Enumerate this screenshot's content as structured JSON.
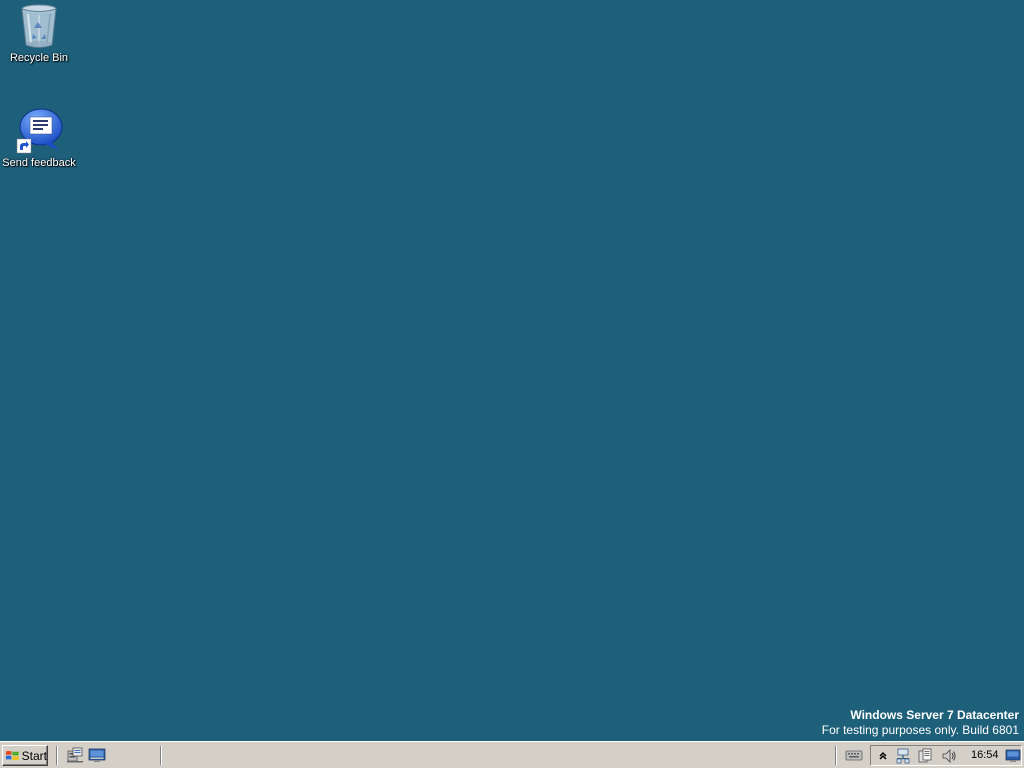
{
  "desktop": {
    "background_color": "#1e5f7a",
    "icons": [
      {
        "label": "Recycle Bin",
        "icon": "recycle-bin-icon"
      },
      {
        "label": "Send feedback",
        "icon": "send-feedback-icon"
      }
    ],
    "watermark": {
      "line1": "Windows Server 7 Datacenter",
      "line2": "For testing purposes only. Build 6801"
    }
  },
  "taskbar": {
    "start_label": "Start",
    "quick_launch": [
      "server-manager-icon",
      "show-desktop-icon"
    ],
    "tray": {
      "icons": [
        "show-hidden-icons-chevron",
        "network-icon",
        "action-center-icon",
        "volume-icon"
      ],
      "clock": "16:54"
    }
  }
}
